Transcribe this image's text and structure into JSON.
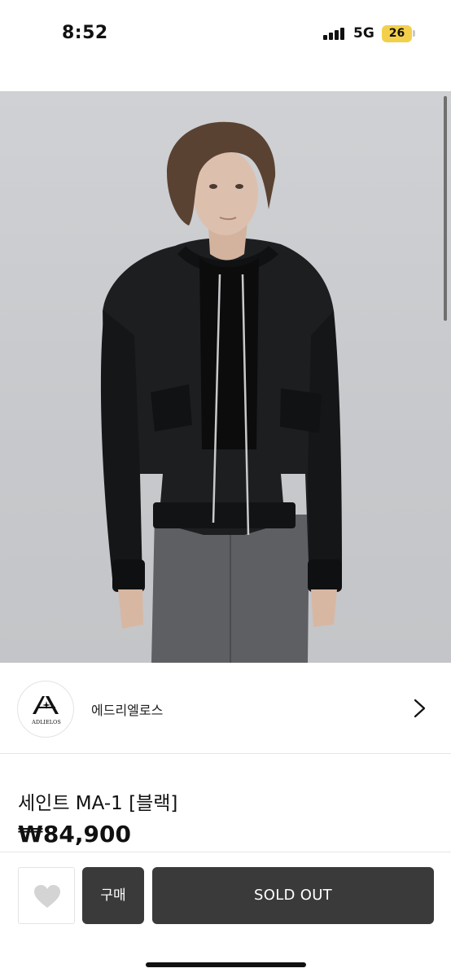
{
  "status_bar": {
    "time": "8:52",
    "network": "5G",
    "battery_level": "26",
    "battery_color": "#f2d04b"
  },
  "product_image": {
    "subject": "model wearing black MA-1 bomber jacket"
  },
  "seller": {
    "logo_text": "ADLIELOS",
    "name": "에드리엘로스",
    "chevron_icon": "chevron-right-icon"
  },
  "product": {
    "title": "세인트 MA-1 [블랙]",
    "price": "₩84,900"
  },
  "actions": {
    "like_icon": "heart-icon",
    "buy_label": "구매",
    "soldout_label": "SOLD OUT",
    "button_color": "#3a3a3a"
  }
}
